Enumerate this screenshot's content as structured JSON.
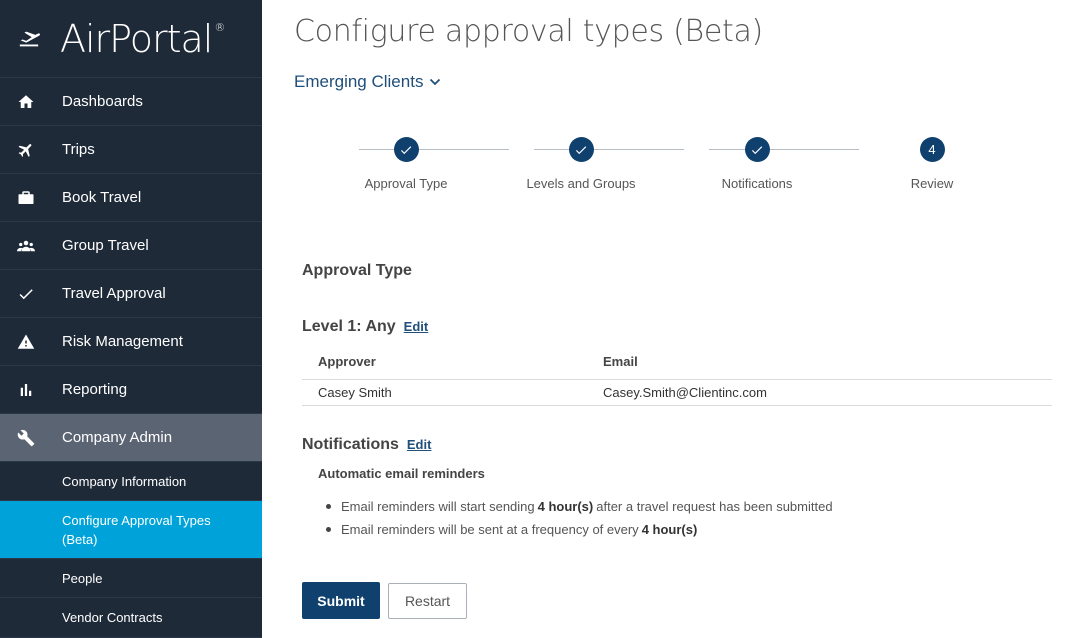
{
  "brand": {
    "name": "AirPortal",
    "reg": "®",
    "icon": "airplane-icon"
  },
  "nav": {
    "items": [
      {
        "label": "Dashboards",
        "icon": "home-icon"
      },
      {
        "label": "Trips",
        "icon": "airplane-icon"
      },
      {
        "label": "Book Travel",
        "icon": "briefcase-icon"
      },
      {
        "label": "Group Travel",
        "icon": "group-icon"
      },
      {
        "label": "Travel Approval",
        "icon": "check-icon"
      },
      {
        "label": "Risk Management",
        "icon": "warning-icon"
      },
      {
        "label": "Reporting",
        "icon": "bar-chart-icon"
      },
      {
        "label": "Company Admin",
        "icon": "wrench-icon",
        "active": true
      }
    ],
    "sub_items": [
      {
        "label": "Company Information"
      },
      {
        "label": "Configure Approval Types (Beta)",
        "selected": true
      },
      {
        "label": "People"
      },
      {
        "label": "Vendor Contracts"
      }
    ]
  },
  "page": {
    "title": "Configure approval types (Beta)",
    "client": "Emerging Clients"
  },
  "stepper": {
    "steps": [
      {
        "label": "Approval Type",
        "done": true
      },
      {
        "label": "Levels and Groups",
        "done": true
      },
      {
        "label": "Notifications",
        "done": true
      },
      {
        "label": "Review",
        "number": "4"
      }
    ]
  },
  "review": {
    "approval_type_heading": "Approval Type",
    "level_heading": "Level 1: Any",
    "edit_label": "Edit",
    "table": {
      "headers": [
        "Approver",
        "Email"
      ],
      "rows": [
        [
          "Casey Smith",
          "Casey.Smith@Clientinc.com"
        ]
      ]
    },
    "notifications_heading": "Notifications",
    "auto_heading": "Automatic email reminders",
    "bullet1": {
      "pre": "Email reminders will start sending",
      "bold": "4 hour(s)",
      "post": "after a travel request has been submitted"
    },
    "bullet2": {
      "pre": "Email reminders will be sent at a frequency of every",
      "bold": "4 hour(s)"
    }
  },
  "buttons": {
    "submit": "Submit",
    "restart": "Restart"
  },
  "colors": {
    "sidebar": "#1f2a38",
    "active_nav": "#5a6473",
    "selected_sub": "#00a3d9",
    "primary": "#10416e",
    "link": "#1f4f7a"
  }
}
